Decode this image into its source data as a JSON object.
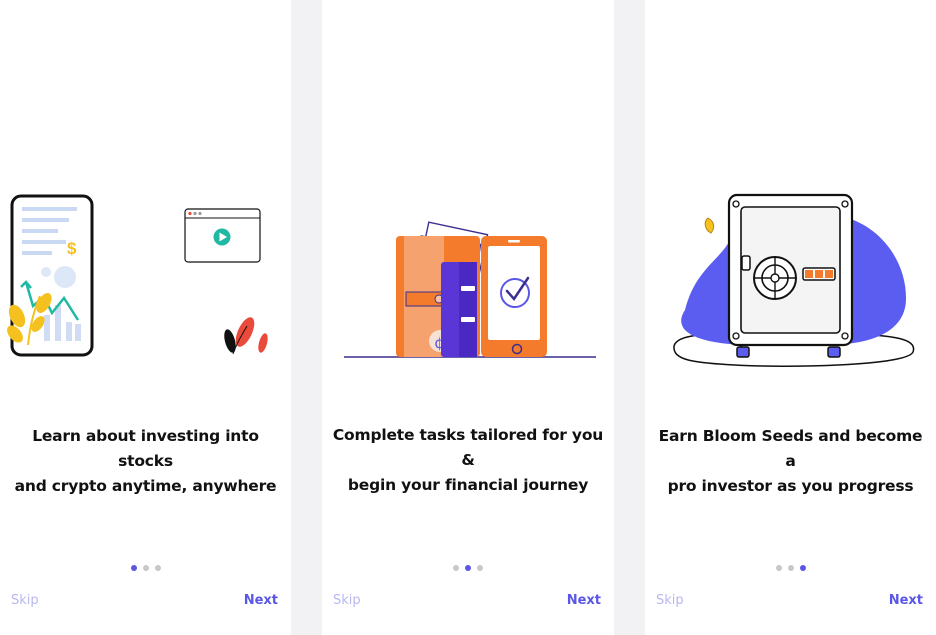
{
  "colors": {
    "accent": "#5b57e6",
    "accent_light": "#b9b7ef",
    "orange": "#f47b2c",
    "teal": "#21b9a4",
    "yellow": "#f5c11e",
    "red": "#ea4a3a"
  },
  "screens": [
    {
      "illustration": "phone-stock-chart-illustration",
      "caption_line1": "Learn about investing into stocks",
      "caption_line2": "and crypto anytime, anywhere",
      "dollar_sign": "$",
      "active_dot": 0,
      "skip_label": "Skip",
      "next_label": "Next"
    },
    {
      "illustration": "wallet-phone-checkmark-illustration",
      "caption_line1": "Complete tasks tailored for you &",
      "caption_line2": "begin your financial journey",
      "active_dot": 1,
      "skip_label": "Skip",
      "next_label": "Next"
    },
    {
      "illustration": "safe-vault-illustration",
      "caption_line1": "Earn Bloom Seeds and become a",
      "caption_line2": "pro investor as you progress",
      "active_dot": 2,
      "skip_label": "Skip",
      "next_label": "Next"
    }
  ]
}
